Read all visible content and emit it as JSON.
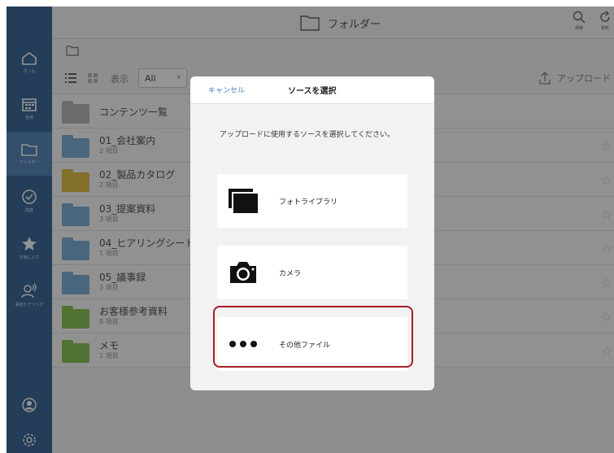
{
  "topbar": {
    "title": "フォルダー",
    "search_label": "検索",
    "refresh_label": "更新"
  },
  "sidebar": {
    "items": [
      {
        "label": "ホーム",
        "icon": "home-icon"
      },
      {
        "label": "全体",
        "icon": "calendar-icon"
      },
      {
        "label": "フォルダー",
        "icon": "folder-icon",
        "active": true
      },
      {
        "label": "既読",
        "icon": "check-circle-icon"
      },
      {
        "label": "お気に入り",
        "icon": "star-icon"
      },
      {
        "label": "事前ヒアリング",
        "icon": "user-broadcast-icon"
      },
      {
        "label": "",
        "icon": "account-icon"
      },
      {
        "label": "",
        "icon": "gear-icon"
      }
    ]
  },
  "toolbar": {
    "view_label": "表示",
    "filter_value": "All",
    "upload_label": "アップロード"
  },
  "folders": [
    {
      "name": "コンテンツ一覧",
      "count": "",
      "color": "#b8b8b8"
    },
    {
      "name": "01_会社案内",
      "count": "2 項目",
      "color": "#7fb0d6"
    },
    {
      "name": "02_製品カタログ",
      "count": "2 項目",
      "color": "#e0c14a"
    },
    {
      "name": "03_提案資料",
      "count": "3 項目",
      "color": "#7fb0d6"
    },
    {
      "name": "04_ヒアリングシート",
      "count": "1 項目",
      "color": "#7fb0d6"
    },
    {
      "name": "05_議事録",
      "count": "3 項目",
      "color": "#7fb0d6"
    },
    {
      "name": "お客様参考資料",
      "count": "8 項目",
      "color": "#8cc456"
    },
    {
      "name": "メモ",
      "count": "1 項目",
      "color": "#8cc456"
    }
  ],
  "modal": {
    "cancel_label": "キャンセル",
    "title": "ソースを選択",
    "prompt": "アップロードに使用するソースを選択してください。",
    "options": [
      {
        "label": "フォトライブラリ",
        "icon": "photo-library-icon"
      },
      {
        "label": "カメラ",
        "icon": "camera-icon"
      },
      {
        "label": "その他ファイル",
        "icon": "more-dots-icon"
      }
    ],
    "highlight_color": "#a51d25"
  }
}
